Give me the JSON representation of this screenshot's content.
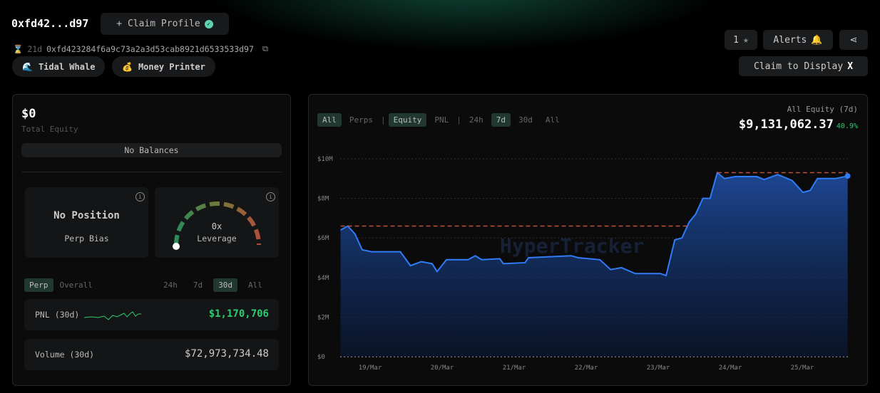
{
  "header": {
    "short_address": "0xfd42...d97",
    "claim_label": "+ Claim Profile",
    "age": "21d",
    "full_address": "0xfd423284f6a9c73a2a3d53cab8921d6533533d97",
    "badges": [
      {
        "icon": "wave-icon",
        "label": "Tidal Whale"
      },
      {
        "icon": "money-bag-icon",
        "label": "Money Printer"
      }
    ],
    "star_count": "1",
    "alerts_label": "Alerts",
    "claim_display_label": "Claim to Display"
  },
  "summary": {
    "total_equity": "$0",
    "total_equity_label": "Total Equity",
    "no_balances": "No Balances",
    "bias_title": "No Position",
    "bias_label": "Perp Bias",
    "leverage_value": "0x",
    "leverage_label": "Leverage",
    "tabs": [
      "Perp",
      "Overall"
    ],
    "periods": [
      "24h",
      "7d",
      "30d",
      "All"
    ],
    "active_period": "30d",
    "pnl_label": "PNL (30d)",
    "pnl_value": "$1,170,706",
    "volume_label": "Volume (30d)",
    "volume_value": "$72,973,734.48"
  },
  "chart_panel": {
    "tabs1": [
      "All",
      "Perps"
    ],
    "tabs2": [
      "Equity",
      "PNL"
    ],
    "periods": [
      "24h",
      "7d",
      "30d",
      "All"
    ],
    "title": "All Equity (7d)",
    "value": "$9,131,062.37",
    "change": "40.9%",
    "watermark": "HyperTracker"
  },
  "colors": {
    "accent": "#2f7cf6",
    "positive": "#2ecc71",
    "dash": "#c0503a"
  },
  "chart_data": {
    "type": "area",
    "ylabel": "",
    "xlabel": "",
    "ylim": [
      0,
      10
    ],
    "y_unit": "$M",
    "yticks": [
      "$0",
      "$2M",
      "$4M",
      "$6M",
      "$8M",
      "$10M"
    ],
    "ytick_values": [
      0,
      2,
      4,
      6,
      8,
      10
    ],
    "xticks": [
      "19/Mar",
      "20/Mar",
      "21/Mar",
      "22/Mar",
      "23/Mar",
      "24/Mar",
      "25/Mar"
    ],
    "series": [
      {
        "name": "Equity",
        "x": [
          -0.41,
          -0.31,
          -0.21,
          -0.11,
          0.02,
          0.42,
          0.56,
          0.71,
          0.86,
          0.93,
          1.06,
          1.36,
          1.46,
          1.55,
          1.8,
          1.85,
          2.15,
          2.2,
          2.79,
          2.89,
          3.19,
          3.34,
          3.49,
          3.68,
          3.83,
          4.03,
          4.11,
          4.23,
          4.33,
          4.43,
          4.52,
          4.62,
          4.72,
          4.82,
          4.92,
          5.07,
          5.37,
          5.47,
          5.66,
          5.86,
          6.01,
          6.11,
          6.21,
          6.46,
          6.63
        ],
        "values": [
          6.4,
          6.6,
          6.2,
          5.4,
          5.3,
          5.3,
          4.6,
          4.8,
          4.7,
          4.3,
          4.9,
          4.9,
          5.1,
          4.9,
          4.95,
          4.7,
          4.75,
          5.0,
          5.1,
          5.0,
          4.9,
          4.4,
          4.5,
          4.2,
          4.2,
          4.2,
          4.1,
          5.9,
          6.0,
          6.8,
          7.2,
          8.0,
          8.0,
          9.3,
          9.0,
          9.1,
          9.1,
          8.95,
          9.2,
          8.9,
          8.3,
          8.4,
          9.0,
          9.0,
          9.13
        ]
      }
    ],
    "reference_lines": [
      {
        "value": 6.6,
        "from": -0.41,
        "to": 4.41
      },
      {
        "value": 9.3,
        "from": 4.82,
        "to": 6.63
      }
    ]
  }
}
